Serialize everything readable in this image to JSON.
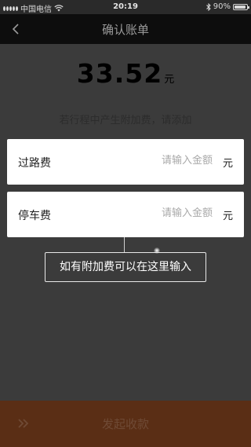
{
  "status_bar": {
    "carrier": "中国电信",
    "time": "20:19",
    "battery_text": "90%",
    "battery_level": 0.9
  },
  "navbar": {
    "title": "确认账单",
    "back_icon": "chevron-left-icon"
  },
  "bill": {
    "amount": "33.52",
    "unit": "元",
    "hint": "若行程中产生附加费，请添加"
  },
  "fees": [
    {
      "label": "过路费",
      "placeholder": "请输入金额",
      "value": "",
      "unit": "元"
    },
    {
      "label": "停车费",
      "placeholder": "请输入金额",
      "value": "",
      "unit": "元"
    }
  ],
  "tooltip": {
    "text": "如有附加费可以在这里输入"
  },
  "bottom": {
    "submit_label": "发起收款",
    "icon": "double-chevron-right-icon"
  },
  "colors": {
    "overlay_bg": "#3b3b3b",
    "navbar_bg": "#0d0d0d",
    "bottom_bg": "#5a2e15"
  }
}
